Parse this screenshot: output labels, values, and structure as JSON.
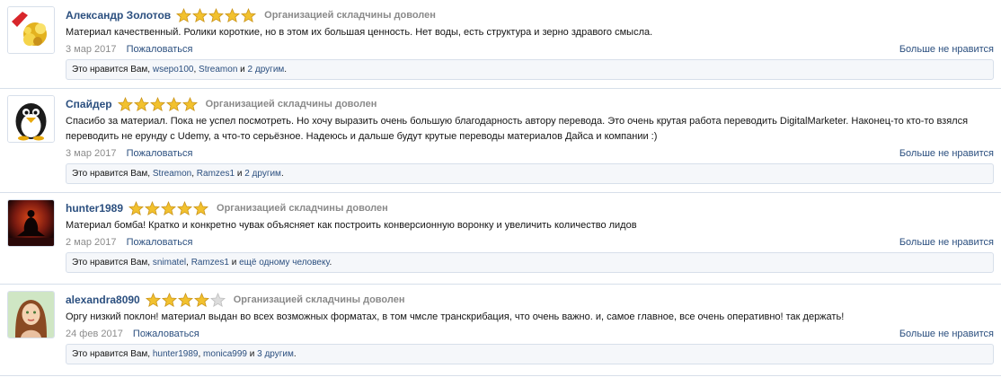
{
  "labels": {
    "report": "Пожаловаться",
    "unlike": "Больше не нравится"
  },
  "colors": {
    "link": "#2b4f7f",
    "star_gold": "#f2c12e",
    "star_empty": "#dcdcdc",
    "border": "#d7dfea"
  },
  "reviews": [
    {
      "author": "Александр Золотов",
      "avatar_icon": "gold-coins-icon",
      "rating": 5,
      "rating_title": "Организацией складчины доволен",
      "text": "Материал качественный. Ролики короткие, но в этом их большая ценность. Нет воды, есть структура и зерно здравого смысла.",
      "date": "3 мар 2017",
      "likes": {
        "prefix": "Это нравится Вам, ",
        "user1": "wsepo100",
        "sep": ", ",
        "user2": "Streamon",
        "and": " и ",
        "others": "2 другим",
        "end": "."
      }
    },
    {
      "author": "Спайдер",
      "avatar_icon": "penguin-icon",
      "rating": 5,
      "rating_title": "Организацией складчины доволен",
      "text": "Спасибо за материал. Пока не успел посмотреть. Но хочу выразить очень большую благодарность автору перевода. Это очень крутая работа переводить DigitalMarketer. Наконец-то кто-то взялся переводить не ерунду с Udemy, а что-то серьёзное. Надеюсь и дальше будут крутые переводы материалов Дайса и компании :)",
      "date": "3 мар 2017",
      "likes": {
        "prefix": "Это нравится Вам, ",
        "user1": "Streamon",
        "sep": ", ",
        "user2": "Ramzes1",
        "and": " и ",
        "others": "2 другим",
        "end": "."
      }
    },
    {
      "author": "hunter1989",
      "avatar_icon": "meditation-silhouette-icon",
      "rating": 5,
      "rating_title": "Организацией складчины доволен",
      "text": "Материал бомба! Кратко и конкретно чувак объясняет как построить конверсионную воронку и увеличить количество лидов",
      "date": "2 мар 2017",
      "likes": {
        "prefix": "Это нравится Вам, ",
        "user1": "snimatel",
        "sep": ", ",
        "user2": "Ramzes1",
        "and": " и ",
        "others": "ещё одному человеку",
        "end": "."
      }
    },
    {
      "author": "alexandra8090",
      "avatar_icon": "girl-portrait-icon",
      "rating": 4,
      "rating_title": "Организацией складчины доволен",
      "text": "Оргу низкий поклон! материал выдан во всех возможных форматах, в том чмсле транскрибация, что очень важно. и, самое главное, все очень оперативно! так держать!",
      "date": "24 фев 2017",
      "likes": {
        "prefix": "Это нравится Вам, ",
        "user1": "hunter1989",
        "sep": ", ",
        "user2": "monica999",
        "and": " и ",
        "others": "3 другим",
        "end": "."
      }
    }
  ]
}
